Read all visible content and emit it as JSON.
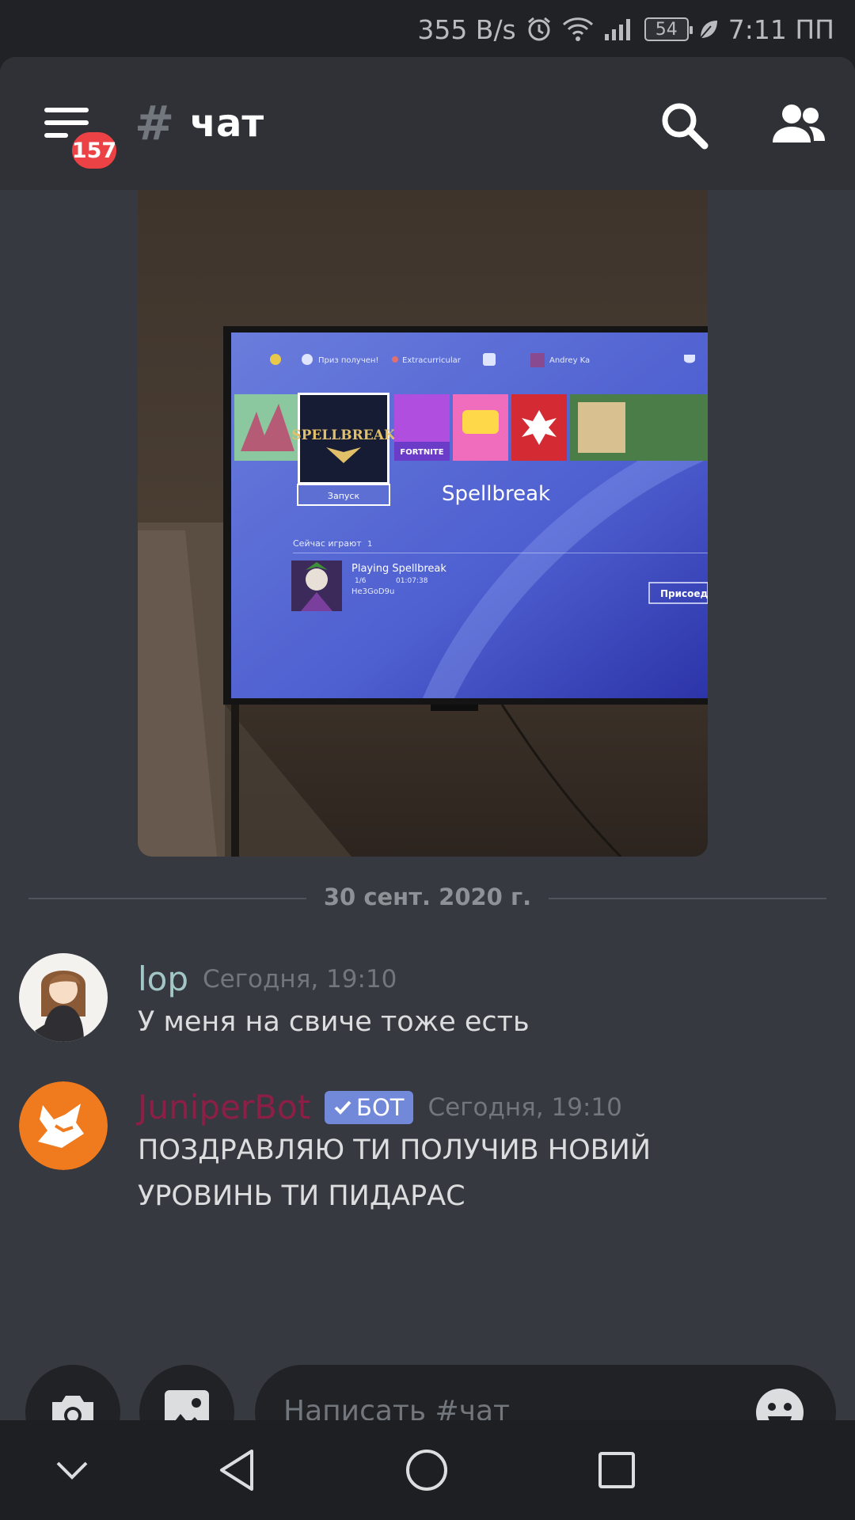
{
  "status_bar": {
    "net_speed": "355 B/s",
    "battery_level": "54",
    "time": "7:11 ПП"
  },
  "header": {
    "unread_badge": "157",
    "channel_hash": "#",
    "channel_name": "чат"
  },
  "attachment": {
    "tv_menu_items": [
      "Приз получен!",
      "Extracurricular",
      "Andrey Ka"
    ],
    "tile_spellbreak_logo": "SPELLBREAK",
    "tile_fortnite": "FORTNITE",
    "tile_launch": "Запуск",
    "selected_game": "Spellbreak",
    "now_playing_label": "Сейчас играют",
    "now_playing_count": "1",
    "playing_title": "Playing Spellbreak",
    "playing_party": "1/6",
    "playing_time": "01:07:38",
    "playing_user": "He3GoD9u",
    "join_button": "Присоеди"
  },
  "date_divider": "30 сент. 2020 г.",
  "messages": [
    {
      "username": "lop",
      "username_color": "#a3c7c7",
      "timestamp": "Сегодня, 19:10",
      "text": "У меня на свиче тоже есть"
    },
    {
      "username": "JuniperBot",
      "username_color": "#8c1f46",
      "bot_tag": "БОТ",
      "timestamp": "Сегодня, 19:10",
      "lines": [
        "ПОЗДРАВЛЯЮ ТИ ПОЛУЧИВ НОВИЙ",
        "УРОВИНЬ ТИ ПИДАРАС"
      ]
    }
  ],
  "composer": {
    "placeholder": "Написать #чат"
  },
  "colors": {
    "app_bg": "#36393f",
    "header_bg": "#2f3136",
    "badge": "#ed4245",
    "bot_tag": "#7289da"
  }
}
